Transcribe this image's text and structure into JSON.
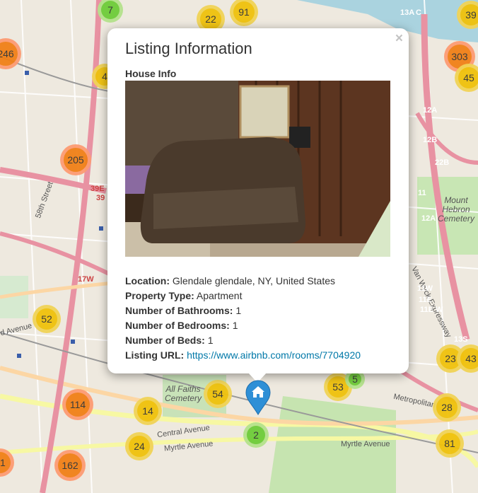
{
  "map": {
    "clusters": [
      {
        "label": "7",
        "color": "#6ecc39",
        "halo": "#b5e28c"
      },
      {
        "label": "22",
        "color": "#f0c20c",
        "halo": "#f1d357"
      },
      {
        "label": "91",
        "color": "#f0c20c",
        "halo": "#f1d357"
      },
      {
        "label": "39",
        "color": "#f0c20c",
        "halo": "#f1d357"
      },
      {
        "label": "246",
        "color": "#f18017",
        "halo": "#fd9c73"
      },
      {
        "label": "303",
        "color": "#f18017",
        "halo": "#fd9c73"
      },
      {
        "label": "45",
        "color": "#f0c20c",
        "halo": "#f1d357"
      },
      {
        "label": "205",
        "color": "#f18017",
        "halo": "#fd9c73"
      },
      {
        "label": "52",
        "color": "#f0c20c",
        "halo": "#f1d357"
      },
      {
        "label": "23",
        "color": "#f0c20c",
        "halo": "#f1d357"
      },
      {
        "label": "43",
        "color": "#f0c20c",
        "halo": "#f1d357"
      },
      {
        "label": "54",
        "color": "#f0c20c",
        "halo": "#f1d357"
      },
      {
        "label": "53",
        "color": "#f0c20c",
        "halo": "#f1d357"
      },
      {
        "label": "5",
        "color": "#6ecc39",
        "halo": "#b5e28c"
      },
      {
        "label": "114",
        "color": "#f18017",
        "halo": "#fd9c73"
      },
      {
        "label": "14",
        "color": "#f0c20c",
        "halo": "#f1d357"
      },
      {
        "label": "28",
        "color": "#f0c20c",
        "halo": "#f1d357"
      },
      {
        "label": "2",
        "color": "#6ecc39",
        "halo": "#b5e28c"
      },
      {
        "label": "24",
        "color": "#f0c20c",
        "halo": "#f1d357"
      },
      {
        "label": "81",
        "color": "#f0c20c",
        "halo": "#f1d357"
      },
      {
        "label": "162",
        "color": "#f18017",
        "halo": "#fd9c73"
      },
      {
        "label": "91",
        "color": "#f18017",
        "halo": "#fd9c73"
      },
      {
        "label": "4",
        "color": "#f0c20c",
        "halo": "#f1d357"
      }
    ],
    "place_labels": {
      "cemetery1": "All Faiths Cemetery",
      "cemetery2": "Mount Hebron Cemetery",
      "vanwyck": "Van Wyck Expressway",
      "street58": "58th Street",
      "central": "Central Avenue",
      "myrtle1": "Myrtle Avenue",
      "myrtle2": "Myrtle Avenue",
      "metropolitan": "Metropolitan",
      "davenue": "d Avenue"
    },
    "exits": [
      "13A",
      "C",
      "12A",
      "12B",
      "22B",
      "11",
      "12A",
      "17W",
      "11W",
      "11E",
      "11E W",
      "39E",
      "39",
      "13S"
    ]
  },
  "popup": {
    "title": "Listing Information",
    "close_label": "×",
    "subheading": "House Info",
    "photo_icon": "listing-photo",
    "location_label": "Location:",
    "location_value": "Glendale glendale, NY, United States",
    "property_type_label": "Property Type:",
    "property_type_value": "Apartment",
    "bathrooms_label": "Number of Bathrooms:",
    "bathrooms_value": "1",
    "bedrooms_label": "Number of Bedrooms:",
    "bedrooms_value": "1",
    "beds_label": "Number of Beds:",
    "beds_value": "1",
    "url_label": "Listing URL:",
    "url_value": "https://www.airbnb.com/rooms/7704920"
  },
  "marker": {
    "icon": "home-icon",
    "color": "#2e8fd6"
  }
}
